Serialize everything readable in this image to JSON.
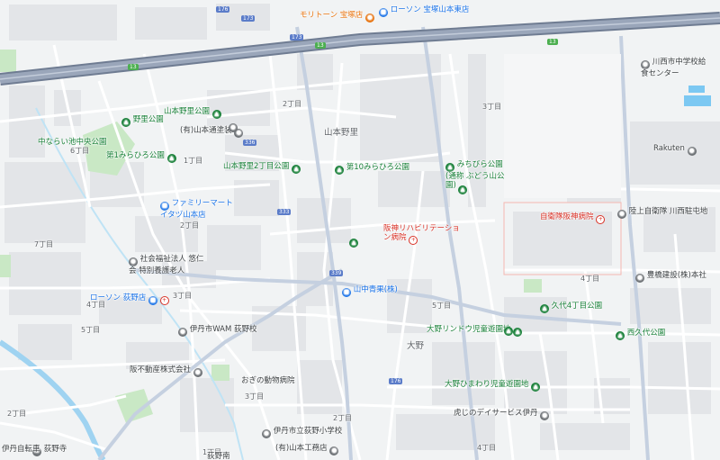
{
  "map": {
    "colors": {
      "background": "#f1f3f4",
      "building": "#e3e5e8",
      "park": "#c9e8c5",
      "road": "#ffffff",
      "highway": "#8e99ab",
      "river": "#9fd3f1",
      "poi_green": "#188038",
      "poi_red": "#d93025",
      "poi_blue": "#1a73e8"
    },
    "labels": {
      "area_yamamotonosato": "山本野里",
      "area_ono": "大野",
      "dist_top": "2丁目",
      "dist_3chome_right": "3丁目",
      "dist_1chome": "1丁目",
      "dist_5chome_left": "5丁目",
      "dist_6chome": "6丁目",
      "dist_3chome_left": "3丁目",
      "dist_4chome": "4丁目",
      "dist_5chome_mid": "5丁目",
      "dist_4chome_right": "4丁目",
      "dist_3chome_mid": "3丁目",
      "dist_2chome_bottom": "2丁目",
      "dist_1chome_bottom": "1丁目",
      "dist_4chome_bottom": "4丁目",
      "dist_7chome": "7丁目",
      "dist_2chome_left": "2丁目",
      "dist_2chome_ll": "2丁目"
    },
    "pois": {
      "motoyama": "モリトーン 宝塚店",
      "lawson_top": "ローソン 宝塚山本東店",
      "yamamoto_nosato_park": "山本野里公園",
      "nosato_park": "野里公園",
      "tanaka_shuchisha": "(有)山本通塗装",
      "nakanishi_park": "中ならい池中央公園",
      "bammi_park": "第1みらひろ公園",
      "yamamoto_nosato2_park": "山本野里2丁目公園",
      "daikyu_park": "第10みらひろ公園",
      "michi_park": "みちびら公園(通称 ぶどう山公園)",
      "familymart": "ファミリーマート イタヅ山本店",
      "hanshin_rehab": "阪神リハビリテーション病院",
      "self_defense_hospital": "自衛隊阪神病院",
      "jsdf_camp": "陸上自衛隊 川西駐屯地",
      "rakuten": "Rakuten",
      "kawanishi_school": "川西市中学校給食センター",
      "shaho": "社会福祉法人 悠仁会 特別養護老人",
      "lawson_ono": "ローソン 荻野店",
      "yamanaka": "山中青果(株)",
      "daiwa": "豊橋建設(株)本社",
      "kumaoka_park": "久代4丁目公園",
      "ono_rindo": "大野リンドウ児童遊園地",
      "ono_wam": "伊丹市WAM 荻野校",
      "kubo_park": "西久代公園",
      "kanri": "阪不動産株式会社",
      "ogino_hospital": "おぎの動物病院",
      "ono_ichiba": "大野ひまわり児童遊園地",
      "ogino_school": "伊丹市立荻野小学校",
      "seven_eleven": "虎じのデイサービス伊丹",
      "ginza_hospital": "(有)山本工務店",
      "tanba": "荻野寺",
      "iko": "伊丹自転車",
      "ogino_south": "荻野南"
    },
    "road_shields": {
      "r1": "176",
      "r2": "173",
      "r3": "13",
      "r4": "13",
      "r5": "173",
      "r6": "336",
      "r7": "333",
      "r8": "339",
      "r9": "13",
      "r10": "176"
    }
  }
}
